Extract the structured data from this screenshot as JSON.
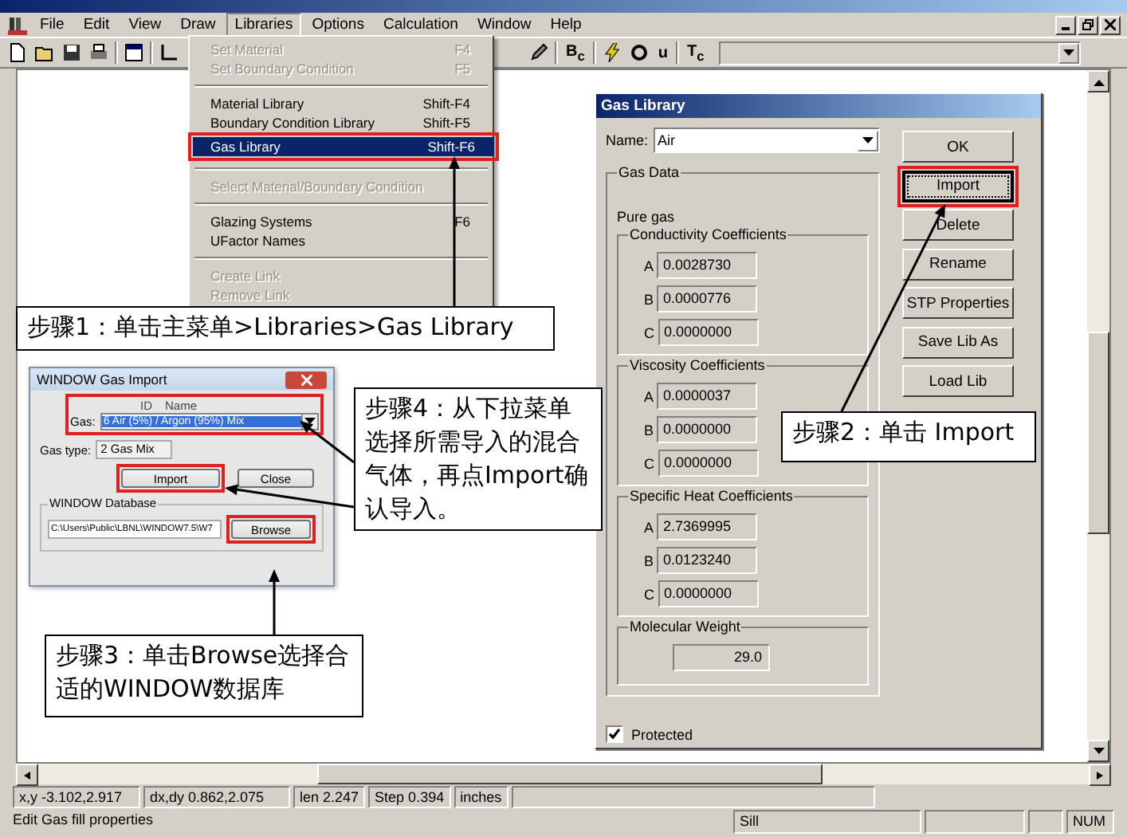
{
  "menu_bar": {
    "items": [
      {
        "label": "File",
        "selected": false
      },
      {
        "label": "Edit",
        "selected": false
      },
      {
        "label": "View",
        "selected": false
      },
      {
        "label": "Draw",
        "selected": false
      },
      {
        "label": "Libraries",
        "selected": true
      },
      {
        "label": "Options",
        "selected": false
      },
      {
        "label": "Calculation",
        "selected": false
      },
      {
        "label": "Window",
        "selected": false
      },
      {
        "label": "Help",
        "selected": false
      }
    ]
  },
  "toolbar": {
    "text_buttons": [
      "B$_{c}$",
      "u",
      "T$_{c}$"
    ]
  },
  "libraries_menu": {
    "items": [
      {
        "kind": "item",
        "label": "Set Material",
        "shortcut": "F4",
        "disabled": true,
        "selected": false
      },
      {
        "kind": "item",
        "label": "Set Boundary Condition",
        "shortcut": "F5",
        "disabled": true,
        "selected": false
      },
      {
        "kind": "separator"
      },
      {
        "kind": "item",
        "label": "Material Library",
        "shortcut": "Shift-F4",
        "disabled": false,
        "selected": false
      },
      {
        "kind": "item",
        "label": "Boundary Condition Library",
        "shortcut": "Shift-F5",
        "disabled": false,
        "selected": false
      },
      {
        "kind": "item",
        "label": "Gas Library",
        "shortcut": "Shift-F6",
        "disabled": false,
        "selected": true
      },
      {
        "kind": "separator"
      },
      {
        "kind": "item",
        "label": "Select Material/Boundary Condition",
        "disabled": true,
        "selected": false
      },
      {
        "kind": "separator"
      },
      {
        "kind": "item",
        "label": "Glazing Systems",
        "shortcut": "F6",
        "disabled": false,
        "selected": false
      },
      {
        "kind": "item",
        "label": "UFactor Names",
        "disabled": false,
        "selected": false
      },
      {
        "kind": "separator"
      },
      {
        "kind": "item",
        "label": "Create Link",
        "disabled": true,
        "selected": false
      },
      {
        "kind": "item",
        "label": "Remove Link",
        "disabled": true,
        "selected": false
      }
    ]
  },
  "gas_import_dialog": {
    "title": "WINDOW Gas Import",
    "column_labels": [
      "ID",
      "Name"
    ],
    "gas_label": "Gas:",
    "gas_value": "6 Air (5%) / Argon (95%) Mix",
    "gas_type_label": "Gas type:",
    "gas_type_value": "2 Gas Mix",
    "buttons": [
      "Import",
      "Close"
    ],
    "database_group": "WINDOW Database",
    "database_path": "C:\\Users\\Public\\LBNL\\WINDOW7.5\\W7",
    "browse_button": "Browse"
  },
  "gas_library_dialog": {
    "title": "Gas Library",
    "name_label": "Name:",
    "name_value": "Air",
    "group_title": "Gas Data",
    "gas_kind": "Pure gas",
    "coefficient_groups": [
      {
        "title": "Conductivity Coefficients",
        "rows": [
          {
            "label": "A",
            "value": "0.0028730"
          },
          {
            "label": "B",
            "value": "0.0000776"
          },
          {
            "label": "C",
            "value": "0.0000000"
          }
        ]
      },
      {
        "title": "Viscosity Coefficients",
        "rows": [
          {
            "label": "A",
            "value": "0.0000037"
          },
          {
            "label": "B",
            "value": "0.0000000"
          },
          {
            "label": "C",
            "value": "0.0000000"
          }
        ]
      },
      {
        "title": "Specific Heat Coefficients",
        "rows": [
          {
            "label": "A",
            "value": "2.7369995"
          },
          {
            "label": "B",
            "value": "0.0123240"
          },
          {
            "label": "C",
            "value": "0.0000000"
          }
        ]
      }
    ],
    "molecular_weight": {
      "title": "Molecular Weight",
      "value": "29.0"
    },
    "protected": {
      "label": "Protected",
      "checked": true
    },
    "buttons": [
      {
        "label": "OK",
        "highlighted": false
      },
      {
        "label": "Import",
        "highlighted": true
      },
      {
        "label": "Delete",
        "highlighted": false
      },
      {
        "label": "Rename",
        "highlighted": false
      },
      {
        "label": "STP Properties",
        "highlighted": false
      },
      {
        "label": "Save Lib As",
        "highlighted": false
      },
      {
        "label": "Load Lib",
        "highlighted": false
      }
    ]
  },
  "callouts": [
    {
      "text": "步骤1：单击主菜单>Libraries>Gas Library"
    },
    {
      "text": "步骤4：从下拉菜单选择所需导入的混合气体，再点Import确认导入。"
    },
    {
      "text": "步骤3：单击Browse选择合适的WINDOW数据库"
    },
    {
      "text": "步骤2：单击 Import"
    }
  ],
  "status_bar": {
    "fields": [
      "x,y -3.102,2.917",
      "dx,dy 0.862,2.075",
      "len 2.247",
      "Step 0.394",
      "inches"
    ],
    "message": "Edit Gas fill properties",
    "panels": [
      "Sill",
      "NUM"
    ]
  }
}
